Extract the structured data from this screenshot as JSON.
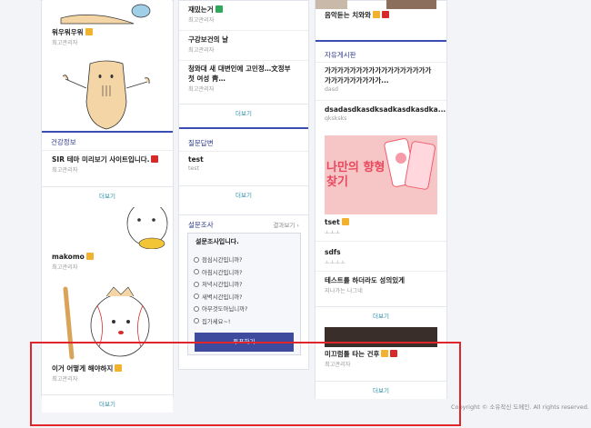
{
  "col1": {
    "top_item": {
      "title": "워우워우워",
      "author": "최고관리자"
    },
    "health_header": "건강정보",
    "health_item": {
      "title": "SIR 테마 미리보기 사이트입니다.",
      "author": "최고관리자"
    },
    "health_more": "더보기",
    "gallery_item1": {
      "title": "makomo",
      "author": "최고관리자"
    },
    "gallery_item2": {
      "title": "이거 어떻게 해야하지",
      "author": "최고관리자"
    },
    "gallery_more": "더보기"
  },
  "col2": {
    "items": [
      {
        "title": "재밌는거",
        "author": "최고관리자"
      },
      {
        "title": "구강보건의 날",
        "author": "최고관리자"
      },
      {
        "title": "청와대 새 대변인에 고민정…文정부 첫 여성 靑…",
        "author": "최고관리자"
      }
    ],
    "more1": "더보기",
    "qa_header": "질문답변",
    "qa_item": {
      "title": "test",
      "author": "test"
    },
    "qa_more": "더보기",
    "poll_header": "설문조사",
    "poll_results": "결과보기 ›",
    "poll_question": "설문조사입니다.",
    "poll_options": [
      "점심시간입니까?",
      "아침시간입니까?",
      "저녁시간입니까?",
      "새벽시간입니까?",
      "아무것도아닙니까?",
      "집가세요~!"
    ],
    "poll_button": "투표하기"
  },
  "col3": {
    "top_item": {
      "title": "음악듣는 치와와",
      "author": ""
    },
    "free_header": "자유게시판",
    "free_items": [
      {
        "title": "가가가가가가가가가가가가가가가가가가가가가가가가가가...",
        "author": "dasd"
      },
      {
        "title": "dsadasdkasdksadkasdkasdka...",
        "author": "qksksks"
      }
    ],
    "promo_text": "나만의 향형 찾기",
    "gallery_items": [
      {
        "title": "tset",
        "author": "ㅗㅗㅗ"
      },
      {
        "title": "sdfs",
        "author": "ㅗㅗㅗㅗ"
      },
      {
        "title": "테스트를 하더라도 성의있게",
        "author": "지나가는 나그네"
      }
    ],
    "more1": "더보기",
    "bottom_item": {
      "title": "미끄럼틀 타는 건후",
      "author": "최고관리자"
    },
    "more2": "더보기"
  },
  "footer": {
    "copyright": "Copyright © 소유작신 도메인. All rights reserved."
  },
  "colors": {
    "accent": "#2b3a8c",
    "highlight": "#e0252b"
  }
}
